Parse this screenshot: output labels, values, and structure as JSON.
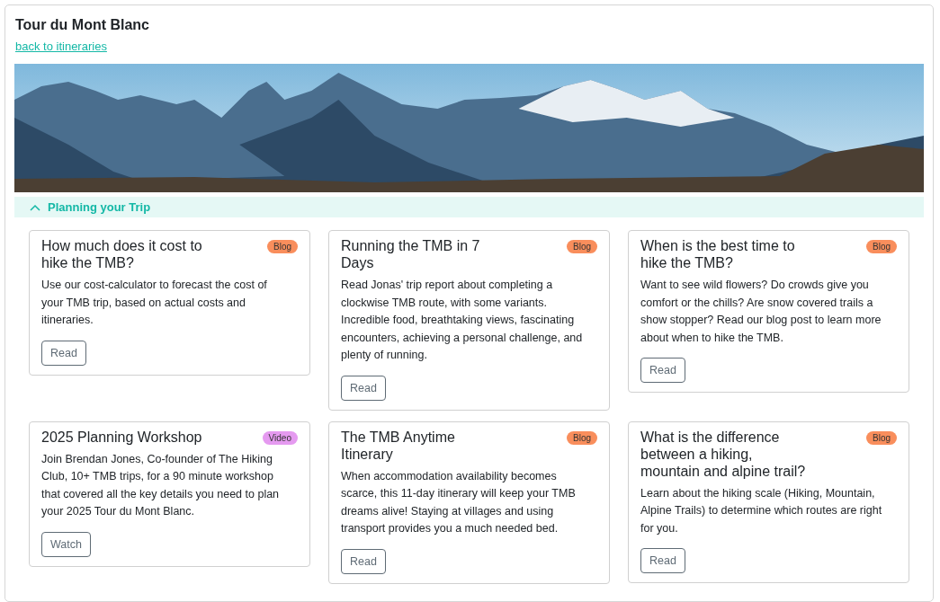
{
  "page": {
    "title": "Tour du Mont Blanc",
    "back_link": "back to itineraries"
  },
  "section": {
    "title": "Planning your Trip",
    "expanded": true
  },
  "cards": [
    {
      "title_lines": [
        "How much does it cost to",
        "hike the TMB?"
      ],
      "tag": "Blog",
      "color": "#f98e5c",
      "description": "Use our cost-calculator to forecast the cost of your TMB trip, based on actual costs and itineraries.",
      "button": "Read"
    },
    {
      "title_lines": [
        "Running the TMB in 7",
        "Days"
      ],
      "tag": "Blog",
      "color": "#f98e5c",
      "description": "Read Jonas' trip report about completing a clockwise TMB route, with some variants. Incredible food, breathtaking views, fascinating encounters, achieving a personal challenge, and plenty of running.",
      "button": "Read"
    },
    {
      "title_lines": [
        "When is the best time to",
        "hike the TMB?"
      ],
      "tag": "Blog",
      "color": "#f98e5c",
      "description": "Want to see wild flowers? Do crowds give you comfort or the chills? Are snow covered trails a show stopper? Read our blog post to learn more about when to hike the TMB.",
      "button": "Read"
    },
    {
      "title_lines": [
        "2025 Planning Workshop"
      ],
      "tag": "Video",
      "color": "#e59af0",
      "description": "Join Brendan Jones, Co-founder of The Hiking Club, 10+ TMB trips, for a 90 minute workshop that covered all the key details you need to plan your 2025 Tour du Mont Blanc.",
      "button": "Watch"
    },
    {
      "title_lines": [
        "The TMB Anytime",
        "Itinerary"
      ],
      "tag": "Blog",
      "color": "#f98e5c",
      "description": "When accommodation availability becomes scarce, this 11-day itinerary will keep your TMB dreams alive! Staying at villages and using transport provides you a much needed bed.",
      "button": "Read"
    },
    {
      "title_lines": [
        "What is the difference",
        "between a hiking,",
        "mountain and alpine trail?"
      ],
      "tag": "Blog",
      "color": "#f98e5c",
      "description": "Learn about the hiking scale (Hiking, Mountain, Alpine Trails) to determine which routes are right for you.",
      "button": "Read"
    }
  ]
}
